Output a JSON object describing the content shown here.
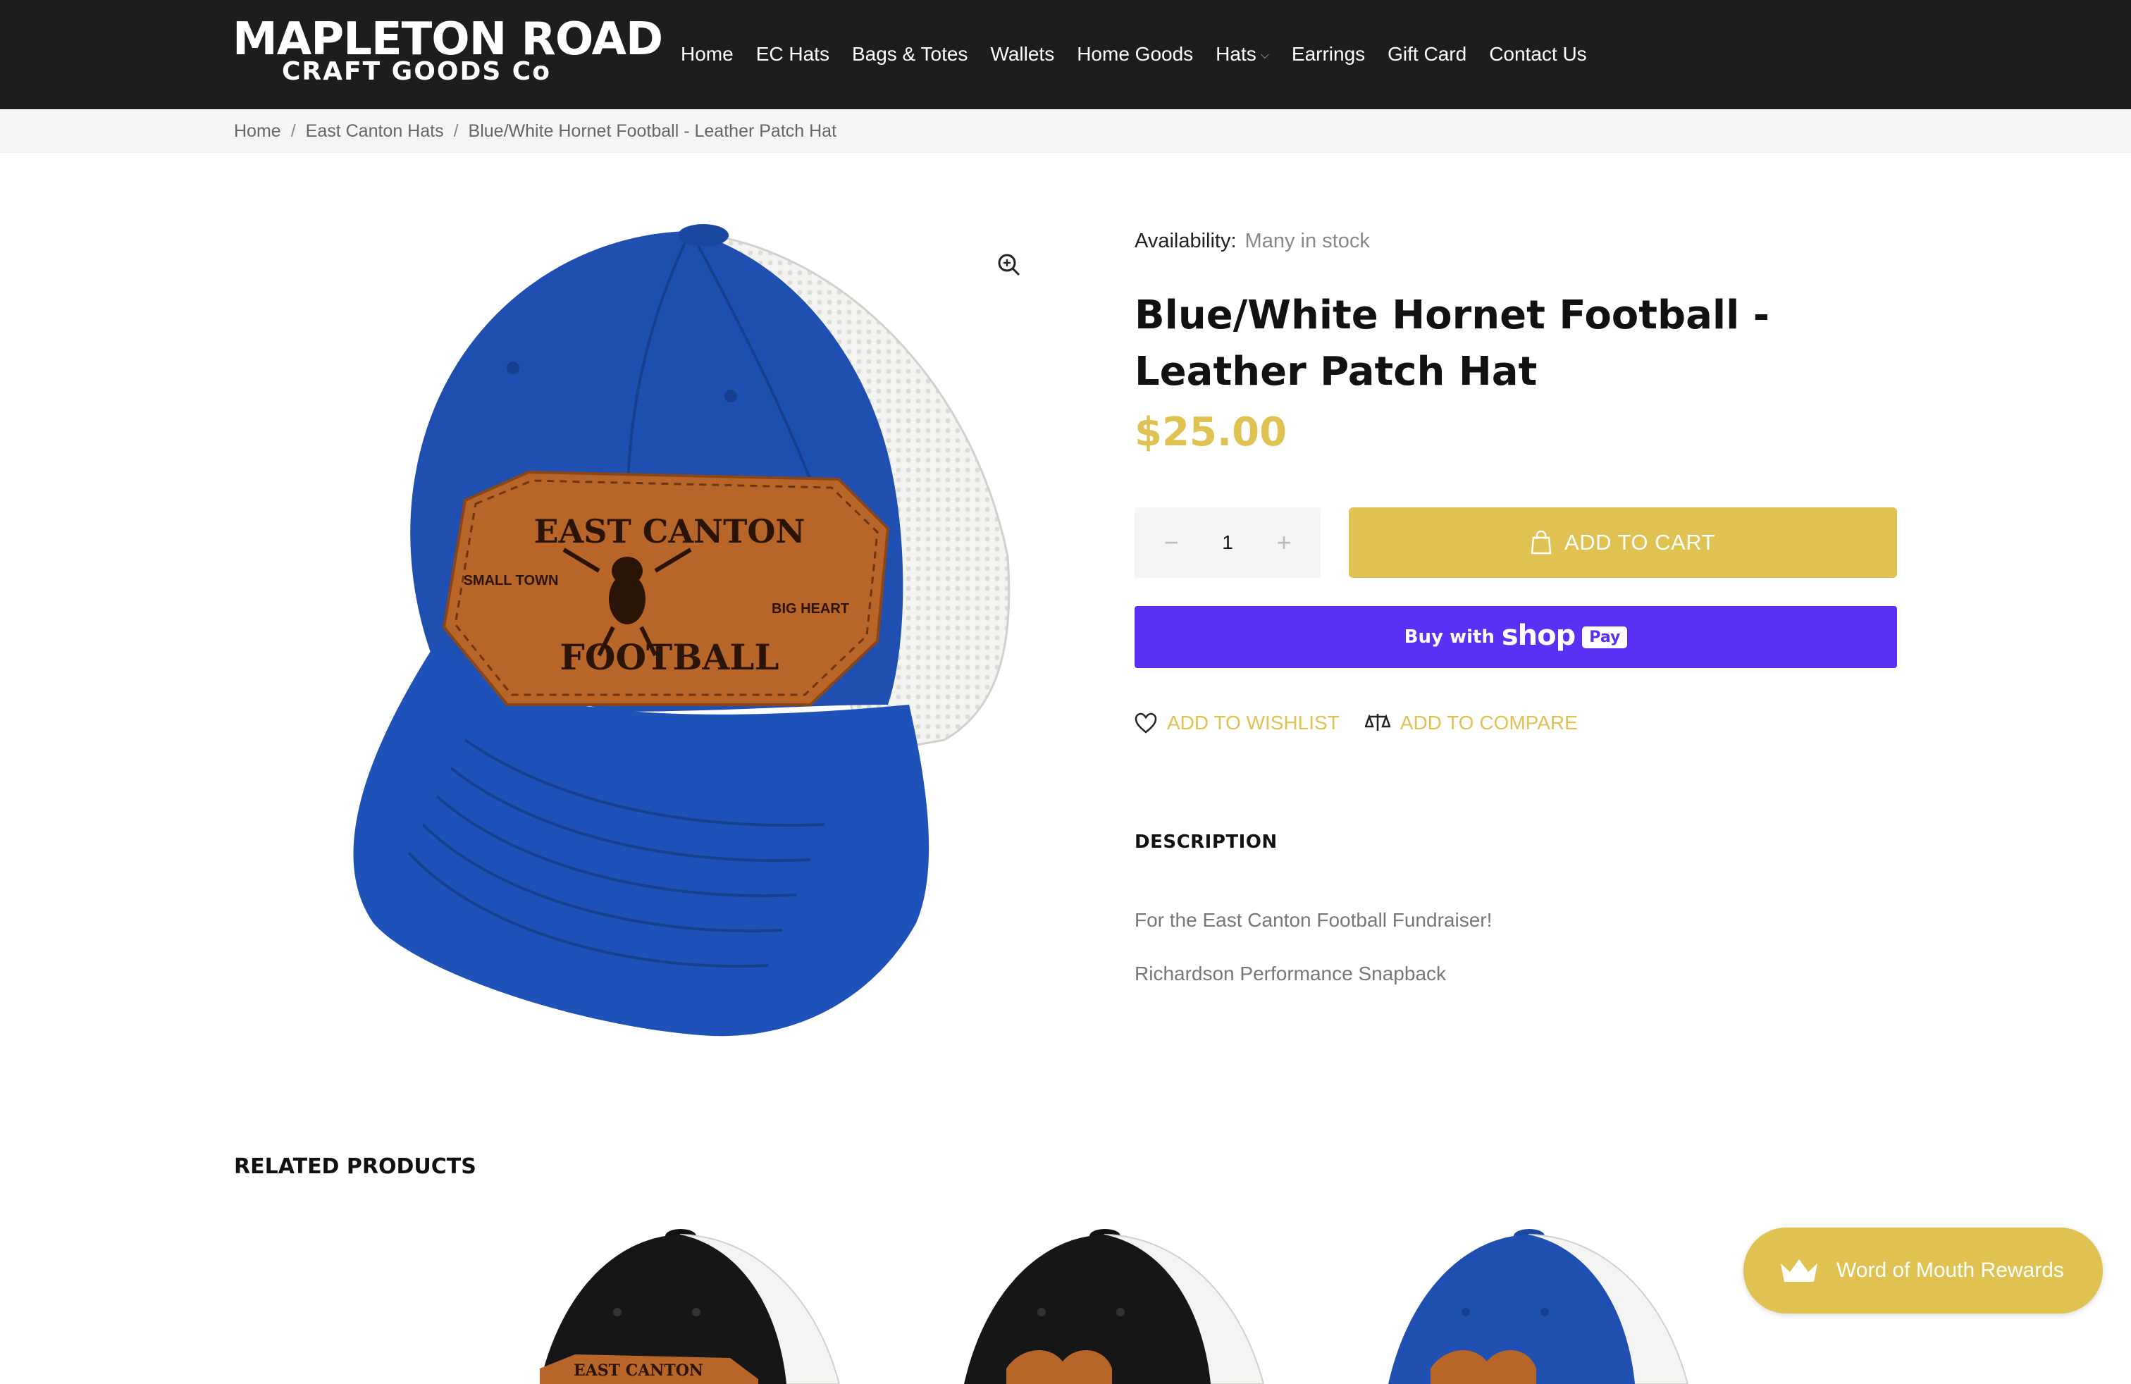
{
  "header": {
    "logo_line1": "MAPLETON ROAD",
    "logo_line2": "CRAFT GOODS Co",
    "nav": [
      "Home",
      "EC Hats",
      "Bags & Totes",
      "Wallets",
      "Home Goods",
      "Hats",
      "Earrings",
      "Gift Card",
      "Contact Us"
    ]
  },
  "breadcrumb": {
    "items": [
      "Home",
      "East Canton Hats",
      "Blue/White Hornet Football - Leather Patch Hat"
    ],
    "separator": "/"
  },
  "product": {
    "availability_label": "Availability:",
    "availability_value": "Many in stock",
    "title": "Blue/White Hornet Football - Leather Patch Hat",
    "price": "$25.00",
    "quantity": "1",
    "add_to_cart": "ADD TO CART",
    "shop_pay_prefix": "Buy with",
    "shop_pay_brand": "shop",
    "shop_pay_badge": "Pay",
    "wishlist": "ADD TO WISHLIST",
    "compare": "ADD TO COMPARE",
    "patch_top": "EAST CANTON",
    "patch_bottom": "FOOTBALL",
    "patch_left": "SMALL TOWN",
    "patch_right": "BIG HEART"
  },
  "description": {
    "heading": "DESCRIPTION",
    "paragraphs": [
      "For the East Canton Football Fundraiser!",
      "Richardson Performance Snapback"
    ]
  },
  "related": {
    "heading": "RELATED PRODUCTS",
    "thumb_patch_text": "EAST CANTON"
  },
  "rewards": {
    "label": "Word of Mouth Rewards"
  },
  "colors": {
    "header_bg": "#1d1d1d",
    "accent": "#dfc252",
    "shop_pay": "#5a31f4",
    "hat_blue": "#1f4fb0",
    "leather": "#b8652a"
  }
}
